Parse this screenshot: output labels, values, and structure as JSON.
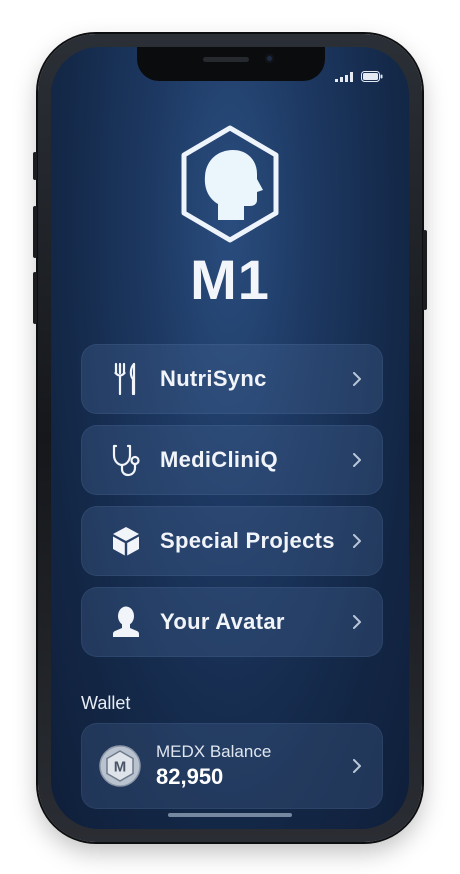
{
  "app": {
    "title": "M1"
  },
  "menu": {
    "items": [
      {
        "label": "NutriSync",
        "icon": "fork-knife-icon"
      },
      {
        "label": "MediCliniQ",
        "icon": "stethoscope-icon"
      },
      {
        "label": "Special Projects",
        "icon": "cube-icon"
      },
      {
        "label": "Your Avatar",
        "icon": "avatar-person-icon"
      }
    ]
  },
  "wallet": {
    "section_label": "Wallet",
    "balance_label": "MEDX Balance",
    "balance_value": "82,950",
    "coin_letter": "M"
  },
  "colors": {
    "background_top": "#2a4d7e",
    "background_bottom": "#0f1f3a",
    "card": "#2f4a72",
    "text": "#f1f4f9"
  }
}
